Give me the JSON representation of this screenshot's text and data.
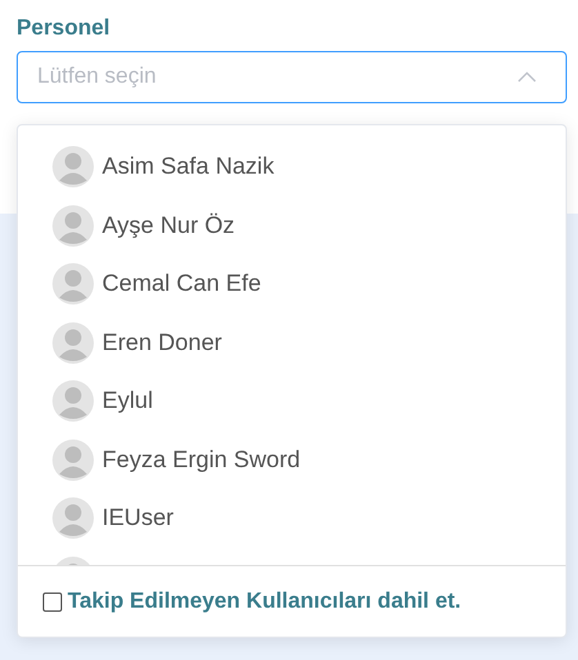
{
  "field": {
    "label": "Personel",
    "placeholder": "Lütfen seçin",
    "expanded": true
  },
  "options": [
    {
      "name": "Asim Safa Nazik"
    },
    {
      "name": "Ayşe Nur Öz"
    },
    {
      "name": "Cemal Can Efe"
    },
    {
      "name": "Eren Doner"
    },
    {
      "name": "Eylul"
    },
    {
      "name": "Feyza Ergin Sword"
    },
    {
      "name": "IEUser"
    }
  ],
  "footer": {
    "label": "Takip Edilmeyen Kullanıcıları dahil et.",
    "checked": false
  }
}
